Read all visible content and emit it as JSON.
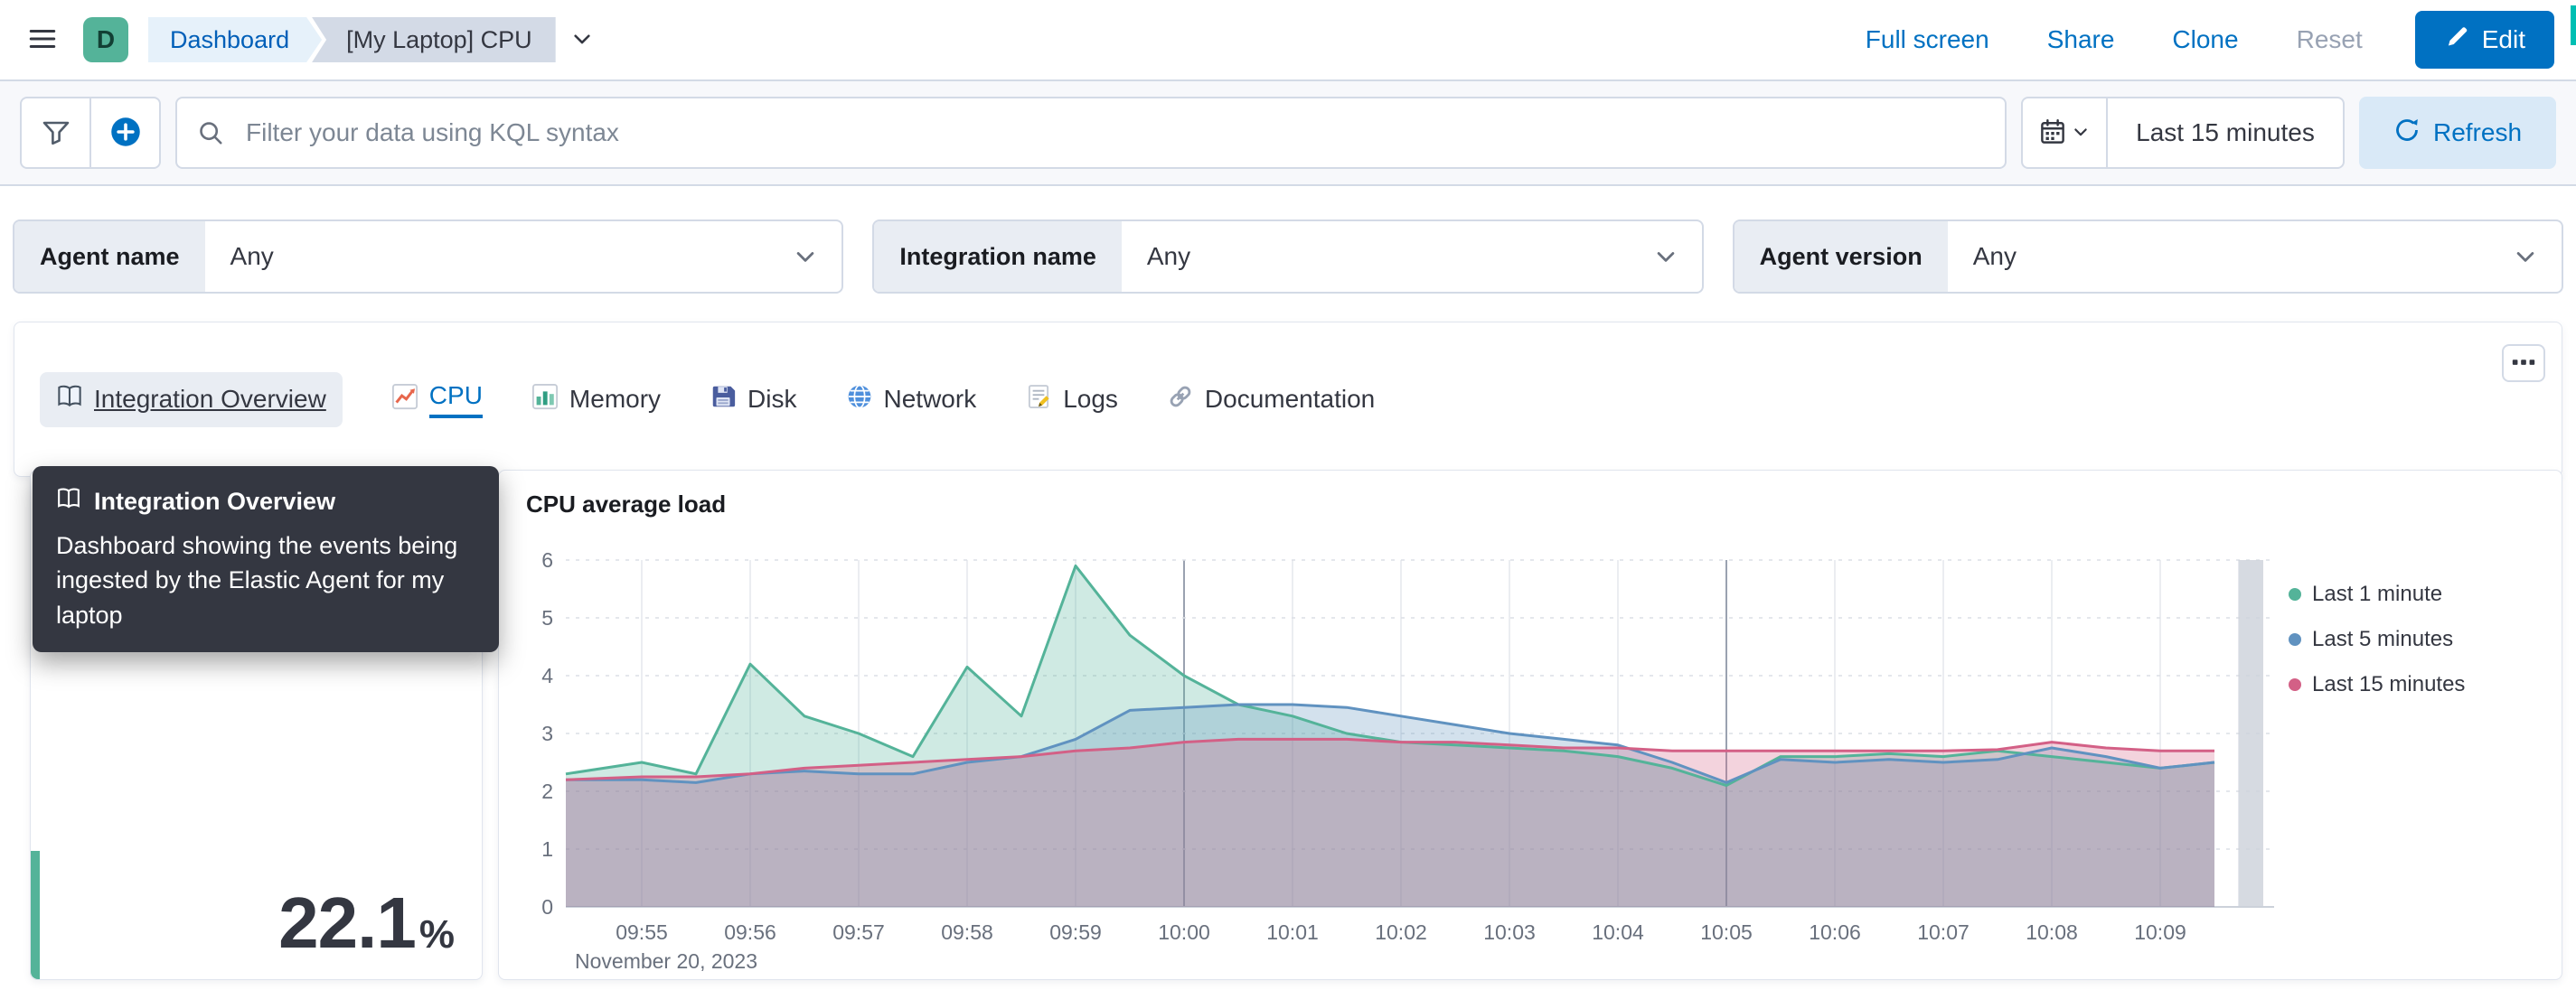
{
  "header": {
    "logo_letter": "D",
    "breadcrumbs": [
      {
        "label": "Dashboard"
      },
      {
        "label": "[My Laptop] CPU"
      }
    ],
    "actions": {
      "full_screen": "Full screen",
      "share": "Share",
      "clone": "Clone",
      "reset": "Reset",
      "edit": "Edit"
    }
  },
  "toolbar": {
    "search_placeholder": "Filter your data using KQL syntax",
    "time_range": "Last 15 minutes",
    "refresh": "Refresh"
  },
  "filters": {
    "agent_name": {
      "label": "Agent name",
      "value": "Any"
    },
    "integration_name": {
      "label": "Integration name",
      "value": "Any"
    },
    "agent_version": {
      "label": "Agent version",
      "value": "Any"
    }
  },
  "tabs": [
    {
      "label": "Integration Overview",
      "icon": "book-icon",
      "state": "hovered"
    },
    {
      "label": "CPU",
      "icon": "line-chart-icon",
      "state": "selected"
    },
    {
      "label": "Memory",
      "icon": "bar-chart-icon",
      "state": "default"
    },
    {
      "label": "Disk",
      "icon": "floppy-disk-icon",
      "state": "default"
    },
    {
      "label": "Network",
      "icon": "globe-icon",
      "state": "default"
    },
    {
      "label": "Logs",
      "icon": "memo-icon",
      "state": "default"
    },
    {
      "label": "Documentation",
      "icon": "link-icon",
      "state": "default"
    }
  ],
  "tooltip": {
    "title": "Integration Overview",
    "body": "Dashboard showing the events being ingested by the Elastic Agent for my laptop"
  },
  "metric": {
    "value": "22.1",
    "unit": "%"
  },
  "chart_data": {
    "type": "area",
    "title": "CPU average load",
    "xlabel": "",
    "ylabel": "",
    "ylim": [
      0,
      6
    ],
    "yticks": [
      0,
      1,
      2,
      3,
      4,
      5,
      6
    ],
    "x_tick_labels": [
      "09:55",
      "09:56",
      "09:57",
      "09:58",
      "09:59",
      "10:00",
      "10:01",
      "10:02",
      "10:03",
      "10:04",
      "10:05",
      "10:06",
      "10:07",
      "10:08",
      "10:09"
    ],
    "x_secondary_label": "November 20, 2023",
    "legend_position": "right",
    "grid": true,
    "x_unit_minutes_from_0955": true,
    "x": [
      -0.7,
      0,
      0.5,
      1,
      1.5,
      2,
      2.5,
      3,
      3.5,
      4,
      4.5,
      5,
      5.5,
      6,
      6.5,
      7,
      7.5,
      8,
      8.5,
      9,
      9.5,
      10,
      10.5,
      11,
      11.5,
      12,
      12.5,
      13,
      13.5,
      14,
      14.5
    ],
    "series": [
      {
        "name": "Last 1 minute",
        "color": "#54B399",
        "values": [
          2.3,
          2.5,
          2.3,
          4.2,
          3.3,
          3.0,
          2.6,
          4.15,
          3.3,
          5.9,
          4.7,
          4.0,
          3.5,
          3.3,
          3.0,
          2.85,
          2.8,
          2.75,
          2.7,
          2.6,
          2.4,
          2.1,
          2.6,
          2.6,
          2.65,
          2.6,
          2.7,
          2.6,
          2.5,
          2.4,
          2.5
        ]
      },
      {
        "name": "Last 5 minutes",
        "color": "#6092C0",
        "values": [
          2.2,
          2.2,
          2.15,
          2.3,
          2.35,
          2.3,
          2.3,
          2.5,
          2.6,
          2.9,
          3.4,
          3.45,
          3.5,
          3.5,
          3.45,
          3.3,
          3.15,
          3.0,
          2.9,
          2.8,
          2.5,
          2.15,
          2.55,
          2.5,
          2.55,
          2.5,
          2.55,
          2.75,
          2.6,
          2.4,
          2.5
        ]
      },
      {
        "name": "Last 15 minutes",
        "color": "#D36086",
        "values": [
          2.2,
          2.25,
          2.25,
          2.3,
          2.4,
          2.45,
          2.5,
          2.55,
          2.6,
          2.7,
          2.75,
          2.85,
          2.9,
          2.9,
          2.9,
          2.85,
          2.85,
          2.8,
          2.75,
          2.75,
          2.7,
          2.7,
          2.7,
          2.7,
          2.7,
          2.7,
          2.72,
          2.85,
          2.75,
          2.7,
          2.7
        ]
      }
    ]
  }
}
